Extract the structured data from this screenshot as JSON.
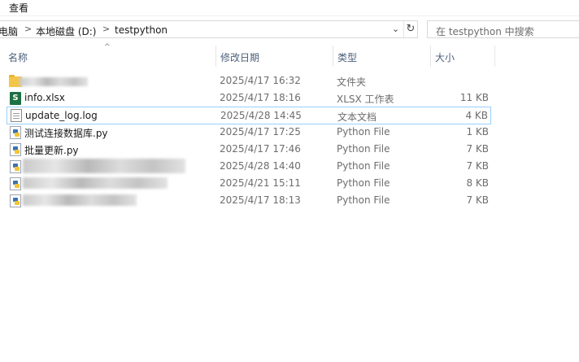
{
  "menu": {
    "view_label": "查看"
  },
  "address": {
    "crumbs": [
      "电脑",
      "本地磁盘 (D:)",
      "testpython"
    ],
    "separator": ">",
    "dropdown_glyph": "⌄",
    "refresh_glyph": "↻"
  },
  "search": {
    "placeholder": "在 testpython 中搜索"
  },
  "columns": {
    "name": "名称",
    "date": "修改日期",
    "type": "类型",
    "size": "大小",
    "sort_glyph": "^"
  },
  "files": [
    {
      "name": "",
      "date": "2025/4/17 16:32",
      "type": "文件夹",
      "size": "",
      "icon": "folder-icon",
      "redacted": true
    },
    {
      "name": "info.xlsx",
      "date": "2025/4/17 18:16",
      "type": "XLSX 工作表",
      "size": "11 KB",
      "icon": "excel-file-icon",
      "icon_glyph": "S"
    },
    {
      "name": "update_log.log",
      "date": "2025/4/28 14:45",
      "type": "文本文档",
      "size": "4 KB",
      "icon": "text-file-icon",
      "selected": true
    },
    {
      "name": "测试连接数据库.py",
      "date": "2025/4/17 17:25",
      "type": "Python File",
      "size": "1 KB",
      "icon": "python-file-icon"
    },
    {
      "name": "批量更新.py",
      "date": "2025/4/17 17:46",
      "type": "Python File",
      "size": "7 KB",
      "icon": "python-file-icon"
    },
    {
      "name": "",
      "date": "2025/4/28 14:40",
      "type": "Python File",
      "size": "7 KB",
      "icon": "python-file-icon",
      "redacted": true
    },
    {
      "name": "",
      "date": "2025/4/21 15:11",
      "type": "Python File",
      "size": "8 KB",
      "icon": "python-file-icon",
      "redacted": true
    },
    {
      "name": "",
      "date": "2025/4/17 18:13",
      "type": "Python File",
      "size": "7 KB",
      "icon": "python-file-icon",
      "redacted": true
    }
  ]
}
